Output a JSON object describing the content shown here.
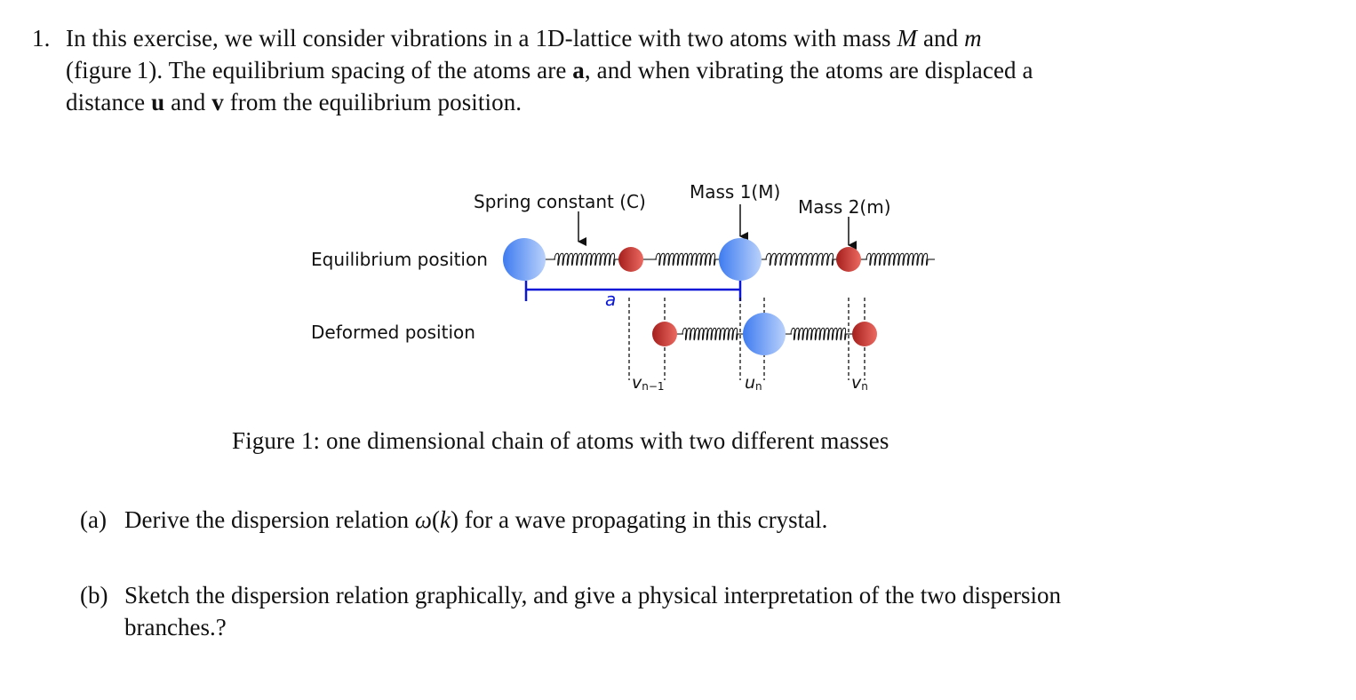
{
  "question": {
    "number": "1.",
    "line1": {
      "pre": "In this exercise, we will consider vibrations in a 1D-lattice with two atoms with mass ",
      "M": "M",
      "and": " and ",
      "m": "m"
    },
    "line2": {
      "pre": "(figure 1). The equilibrium spacing of the atoms are ",
      "a": "a",
      "post": ", and when vibrating the atoms are displaced a"
    },
    "line3": {
      "pre": "distance ",
      "u": "u",
      "and": " and ",
      "v": "v",
      "post": " from the equilibrium position."
    }
  },
  "figure": {
    "labels": {
      "spring_constant": "Spring constant (C)",
      "mass1": "Mass 1(M)",
      "mass2": "Mass 2(m)",
      "equilibrium": "Equilibrium position",
      "deformed": "Deformed position",
      "spacing": "a"
    },
    "displacements": {
      "v_prev": {
        "base": "v",
        "sub": "n−1"
      },
      "u": {
        "base": "u",
        "sub": "n"
      },
      "v": {
        "base": "v",
        "sub": "n"
      }
    },
    "colors": {
      "heavy_atom": "#5b8ff0",
      "light_atom": "#c8322e",
      "spacing_bracket": "#0a17d6",
      "spring": "#111111",
      "bond": "#555555"
    },
    "caption": "Figure 1: one dimensional chain of atoms with two different masses"
  },
  "parts": [
    {
      "label": "(a)",
      "pre": "Derive the dispersion relation ",
      "omega": "ω",
      "open": "(",
      "k": "k",
      "post": ") for a wave propagating in this crystal."
    },
    {
      "label": "(b)",
      "line1": "Sketch the dispersion relation graphically, and give a physical interpretation of the two dispersion",
      "line2": "branches.?"
    }
  ]
}
